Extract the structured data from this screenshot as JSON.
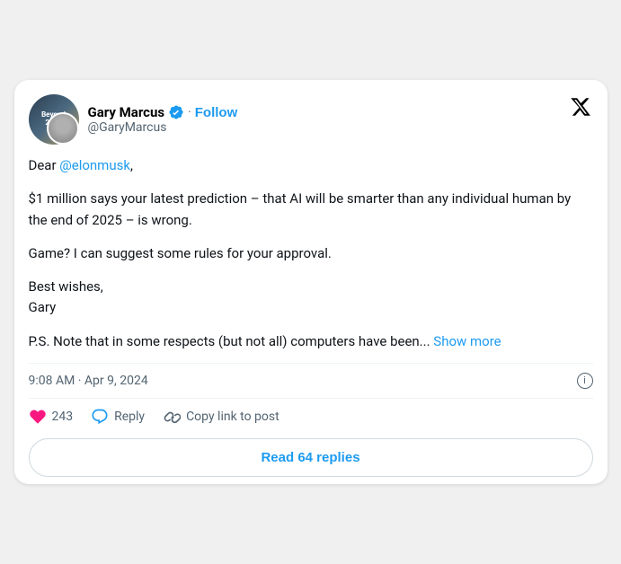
{
  "card": {
    "avatar": {
      "book_line1": "Beyond",
      "book_line2": "2030"
    },
    "header": {
      "name": "Gary Marcus",
      "handle": "@GaryMarcus",
      "follow_label": "Follow",
      "verified": true
    },
    "tweet": {
      "mention": "@elonmusk",
      "paragraph1": "Dear @elonmusk,",
      "paragraph2": "$1 million says your latest prediction – that AI will be smarter than any individual human by the end of 2025 – is wrong.",
      "paragraph3": "Game? I can suggest some rules for your approval.",
      "paragraph4_prefix": "Best wishes,\nGary",
      "paragraph5_prefix": "P.S. Note that in some respects (but not all)  computers have been...",
      "show_more_label": "Show more"
    },
    "timestamp": "9:08 AM · Apr 9, 2024",
    "actions": {
      "likes_count": "243",
      "reply_label": "Reply",
      "copy_link_label": "Copy link to post"
    },
    "read_replies": {
      "label": "Read 64 replies"
    }
  }
}
